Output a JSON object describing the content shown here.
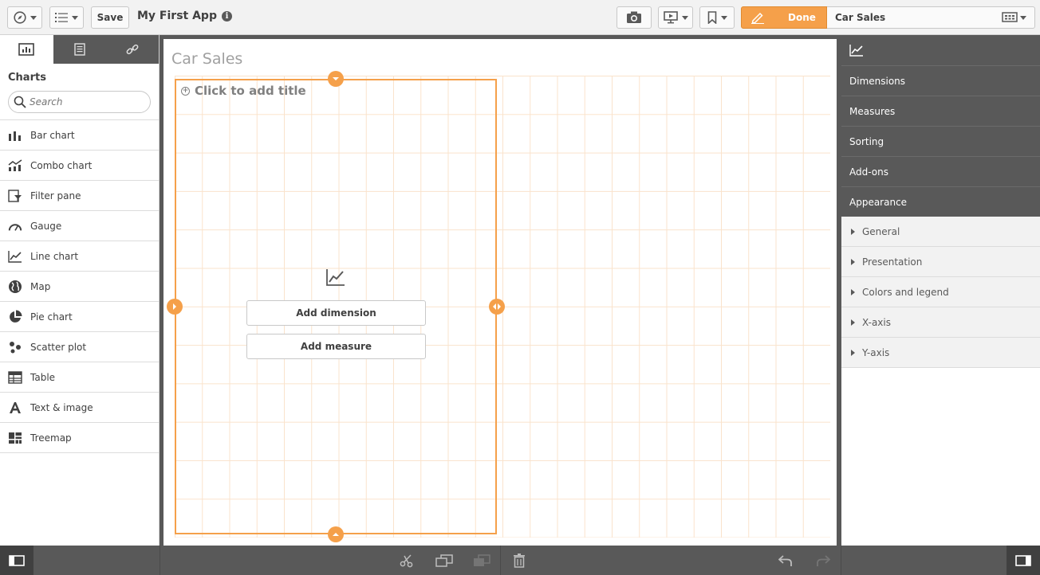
{
  "toolbar": {
    "save_label": "Save",
    "app_title": "My First App",
    "info_glyph": "i",
    "done_label": "Done",
    "sheet_name": "Car Sales",
    "icons": [
      "compass-icon",
      "list-icon",
      "camera-icon",
      "present-icon",
      "bookmark-icon",
      "pencil-icon",
      "sheet-grid-icon"
    ]
  },
  "left_panel": {
    "tabs": [
      "charts-tab",
      "master-items-tab",
      "fields-link-tab"
    ],
    "heading": "Charts",
    "search_placeholder": "Search",
    "items": [
      {
        "label": "Bar chart",
        "icon": "bar-chart-icon"
      },
      {
        "label": "Combo chart",
        "icon": "combo-chart-icon"
      },
      {
        "label": "Filter pane",
        "icon": "filter-pane-icon"
      },
      {
        "label": "Gauge",
        "icon": "gauge-icon"
      },
      {
        "label": "Line chart",
        "icon": "line-chart-icon"
      },
      {
        "label": "Map",
        "icon": "map-icon"
      },
      {
        "label": "Pie chart",
        "icon": "pie-chart-icon"
      },
      {
        "label": "Scatter plot",
        "icon": "scatter-plot-icon"
      },
      {
        "label": "Table",
        "icon": "table-icon"
      },
      {
        "label": "Text & image",
        "icon": "text-image-icon"
      },
      {
        "label": "Treemap",
        "icon": "treemap-icon"
      }
    ]
  },
  "canvas": {
    "sheet_title": "Car Sales",
    "viz_title": "Click to add title",
    "plus_glyph": "+",
    "add_dimension": "Add dimension",
    "add_measure": "Add measure"
  },
  "right_panel": {
    "header_icon": "line-chart-icon",
    "sections": [
      "Dimensions",
      "Measures",
      "Sorting",
      "Add-ons",
      "Appearance"
    ],
    "appearance_items": [
      "General",
      "Presentation",
      "Colors and legend",
      "X-axis",
      "Y-axis"
    ]
  },
  "bottom_bar": {
    "icons": [
      "toggle-left-panel-icon",
      "cut-icon",
      "copy-icon",
      "paste-icon",
      "delete-icon",
      "undo-icon",
      "redo-icon",
      "toggle-right-panel-icon"
    ]
  },
  "colors": {
    "accent": "#f5a04a",
    "panel_dark": "#595959",
    "grid_line": "#fae3cc"
  }
}
